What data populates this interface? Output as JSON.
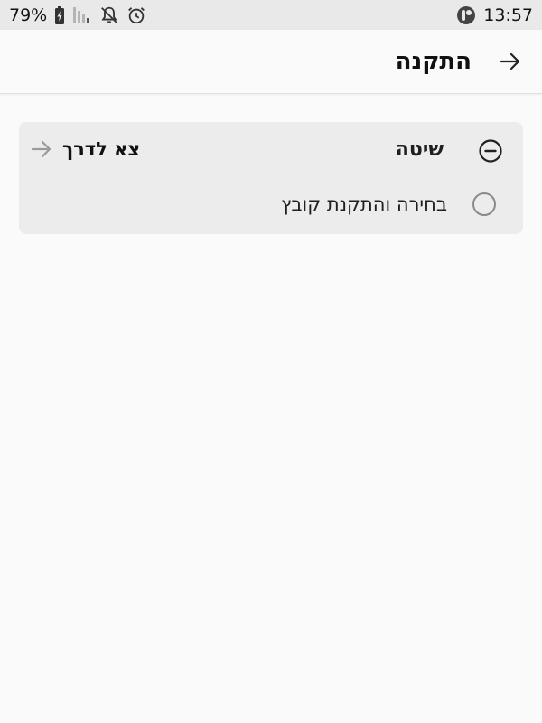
{
  "status_bar": {
    "battery": "79%",
    "time": "13:57",
    "icons": [
      "battery-charging-icon",
      "signal-icon",
      "notifications-off-icon",
      "alarm-icon",
      "app-notification-icon"
    ]
  },
  "app_bar": {
    "title": "התקנה",
    "back_icon": "arrow-right-icon"
  },
  "section": {
    "title": "שיטה",
    "collapse_icon": "minus-circle-icon",
    "goto_label": "צא לדרך",
    "goto_icon": "arrow-right-icon",
    "options": [
      {
        "label": "בחירה והתקנת קובץ",
        "selected": false
      }
    ]
  }
}
